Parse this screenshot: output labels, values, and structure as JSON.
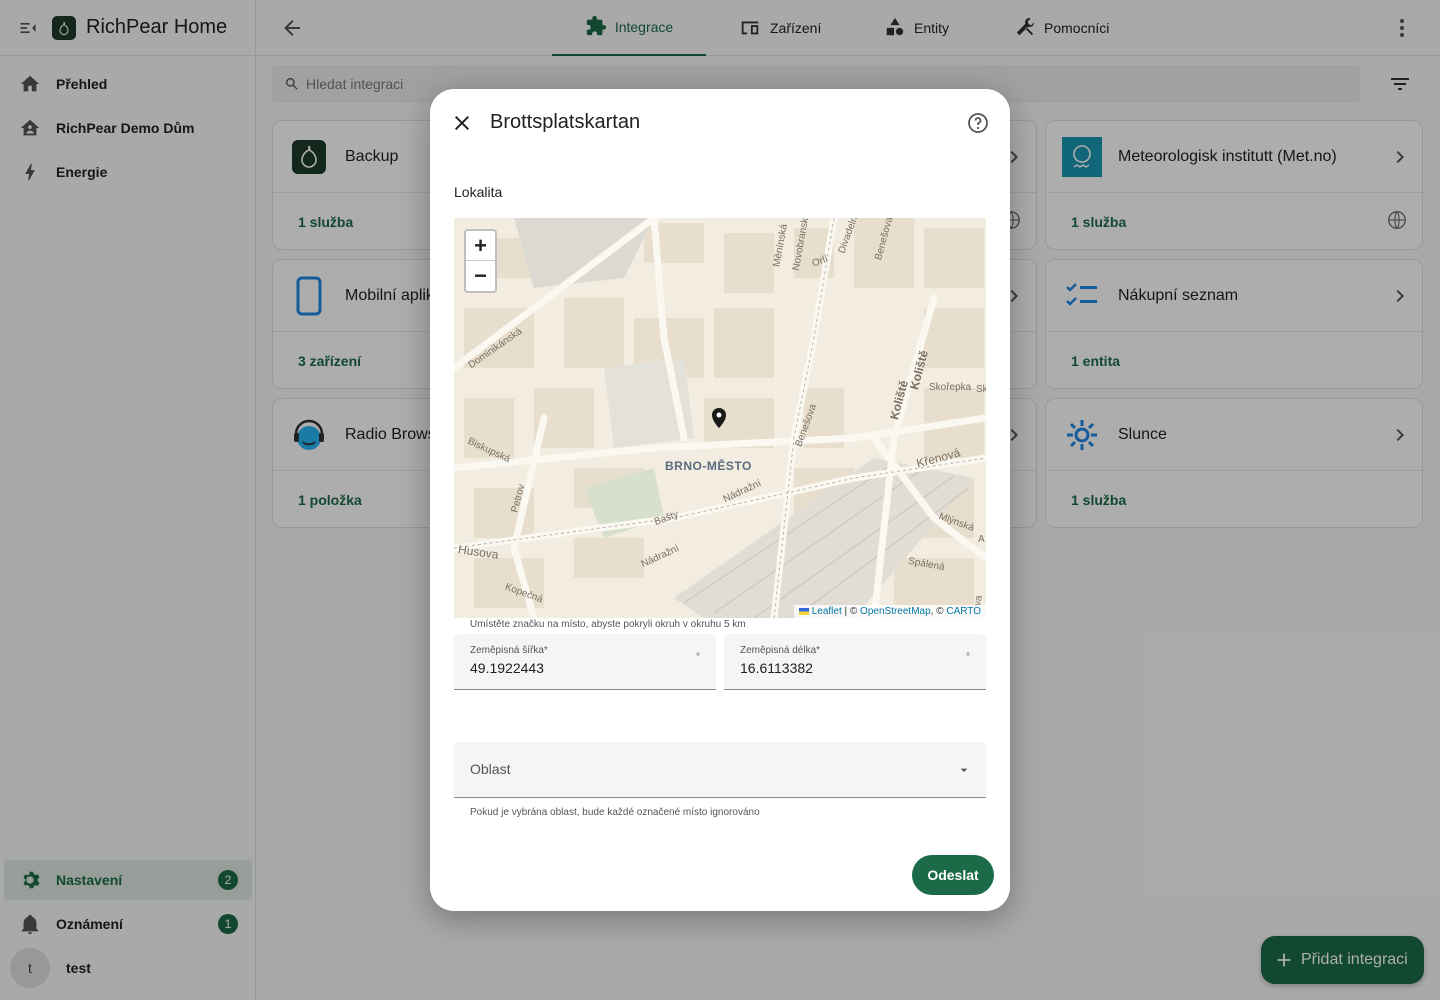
{
  "app": {
    "title": "RichPear Home"
  },
  "sidebar": {
    "items": [
      {
        "label": "Přehled"
      },
      {
        "label": "RichPear Demo Dům"
      },
      {
        "label": "Energie"
      }
    ],
    "settings": {
      "label": "Nastavení",
      "badge": "2"
    },
    "notifications": {
      "label": "Oznámení",
      "badge": "1"
    },
    "user": {
      "initial": "t",
      "name": "test"
    }
  },
  "tabs": [
    {
      "label": "Integrace"
    },
    {
      "label": "Zařízení"
    },
    {
      "label": "Entity"
    },
    {
      "label": "Pomocníci"
    }
  ],
  "search": {
    "placeholder": "Hledat integraci"
  },
  "cards": [
    {
      "name": "Backup",
      "footer": "1 služba"
    },
    {
      "name": "Mobilní aplikace",
      "footer": "3 zařízení"
    },
    {
      "name": "Radio Browser",
      "footer": "1 položka"
    },
    {
      "name": "Meteorologisk institutt (Met.no)",
      "footer": "1 služba"
    },
    {
      "name": "Nákupní seznam",
      "footer": "1 entita"
    },
    {
      "name": "Slunce",
      "footer": "1 služba"
    }
  ],
  "fab": {
    "label": "Přidat integraci"
  },
  "dialog": {
    "title": "Brottsplatskartan",
    "location_label": "Lokalita",
    "map": {
      "district": "BRNO-MĚSTO",
      "zoom_in": "+",
      "zoom_out": "−",
      "streets": [
        "Dominikánská",
        "Měnínská",
        "Novobranská",
        "Orlí",
        "Divadelní",
        "Benešova",
        "Koliště",
        "Koliště",
        "Skořepka",
        "Sk",
        "Křenová",
        "Mlýnská",
        "Spálená",
        "Husova",
        "Kopečná",
        "Nádražní",
        "Nádražní",
        "Bašty",
        "Petrov",
        "Biskupská",
        "Benešova",
        "A",
        "ova"
      ],
      "attribution": {
        "leaflet": "Leaflet",
        "sep1": " | © ",
        "osm": "OpenStreetMap",
        "sep2": ", © ",
        "carto": "CARTO"
      }
    },
    "map_hint": "Umístěte značku na místo, abyste pokryli okruh v okruhu 5 km",
    "latitude": {
      "label": "Zeměpisná šířka*",
      "value": "49.1922443",
      "suffix": "°"
    },
    "longitude": {
      "label": "Zeměpisná délka*",
      "value": "16.6113382",
      "suffix": "°"
    },
    "area": {
      "placeholder": "Oblast",
      "hint": "Pokud je vybrána oblast, bude každé označené místo ignorováno"
    },
    "submit_label": "Odeslat"
  }
}
